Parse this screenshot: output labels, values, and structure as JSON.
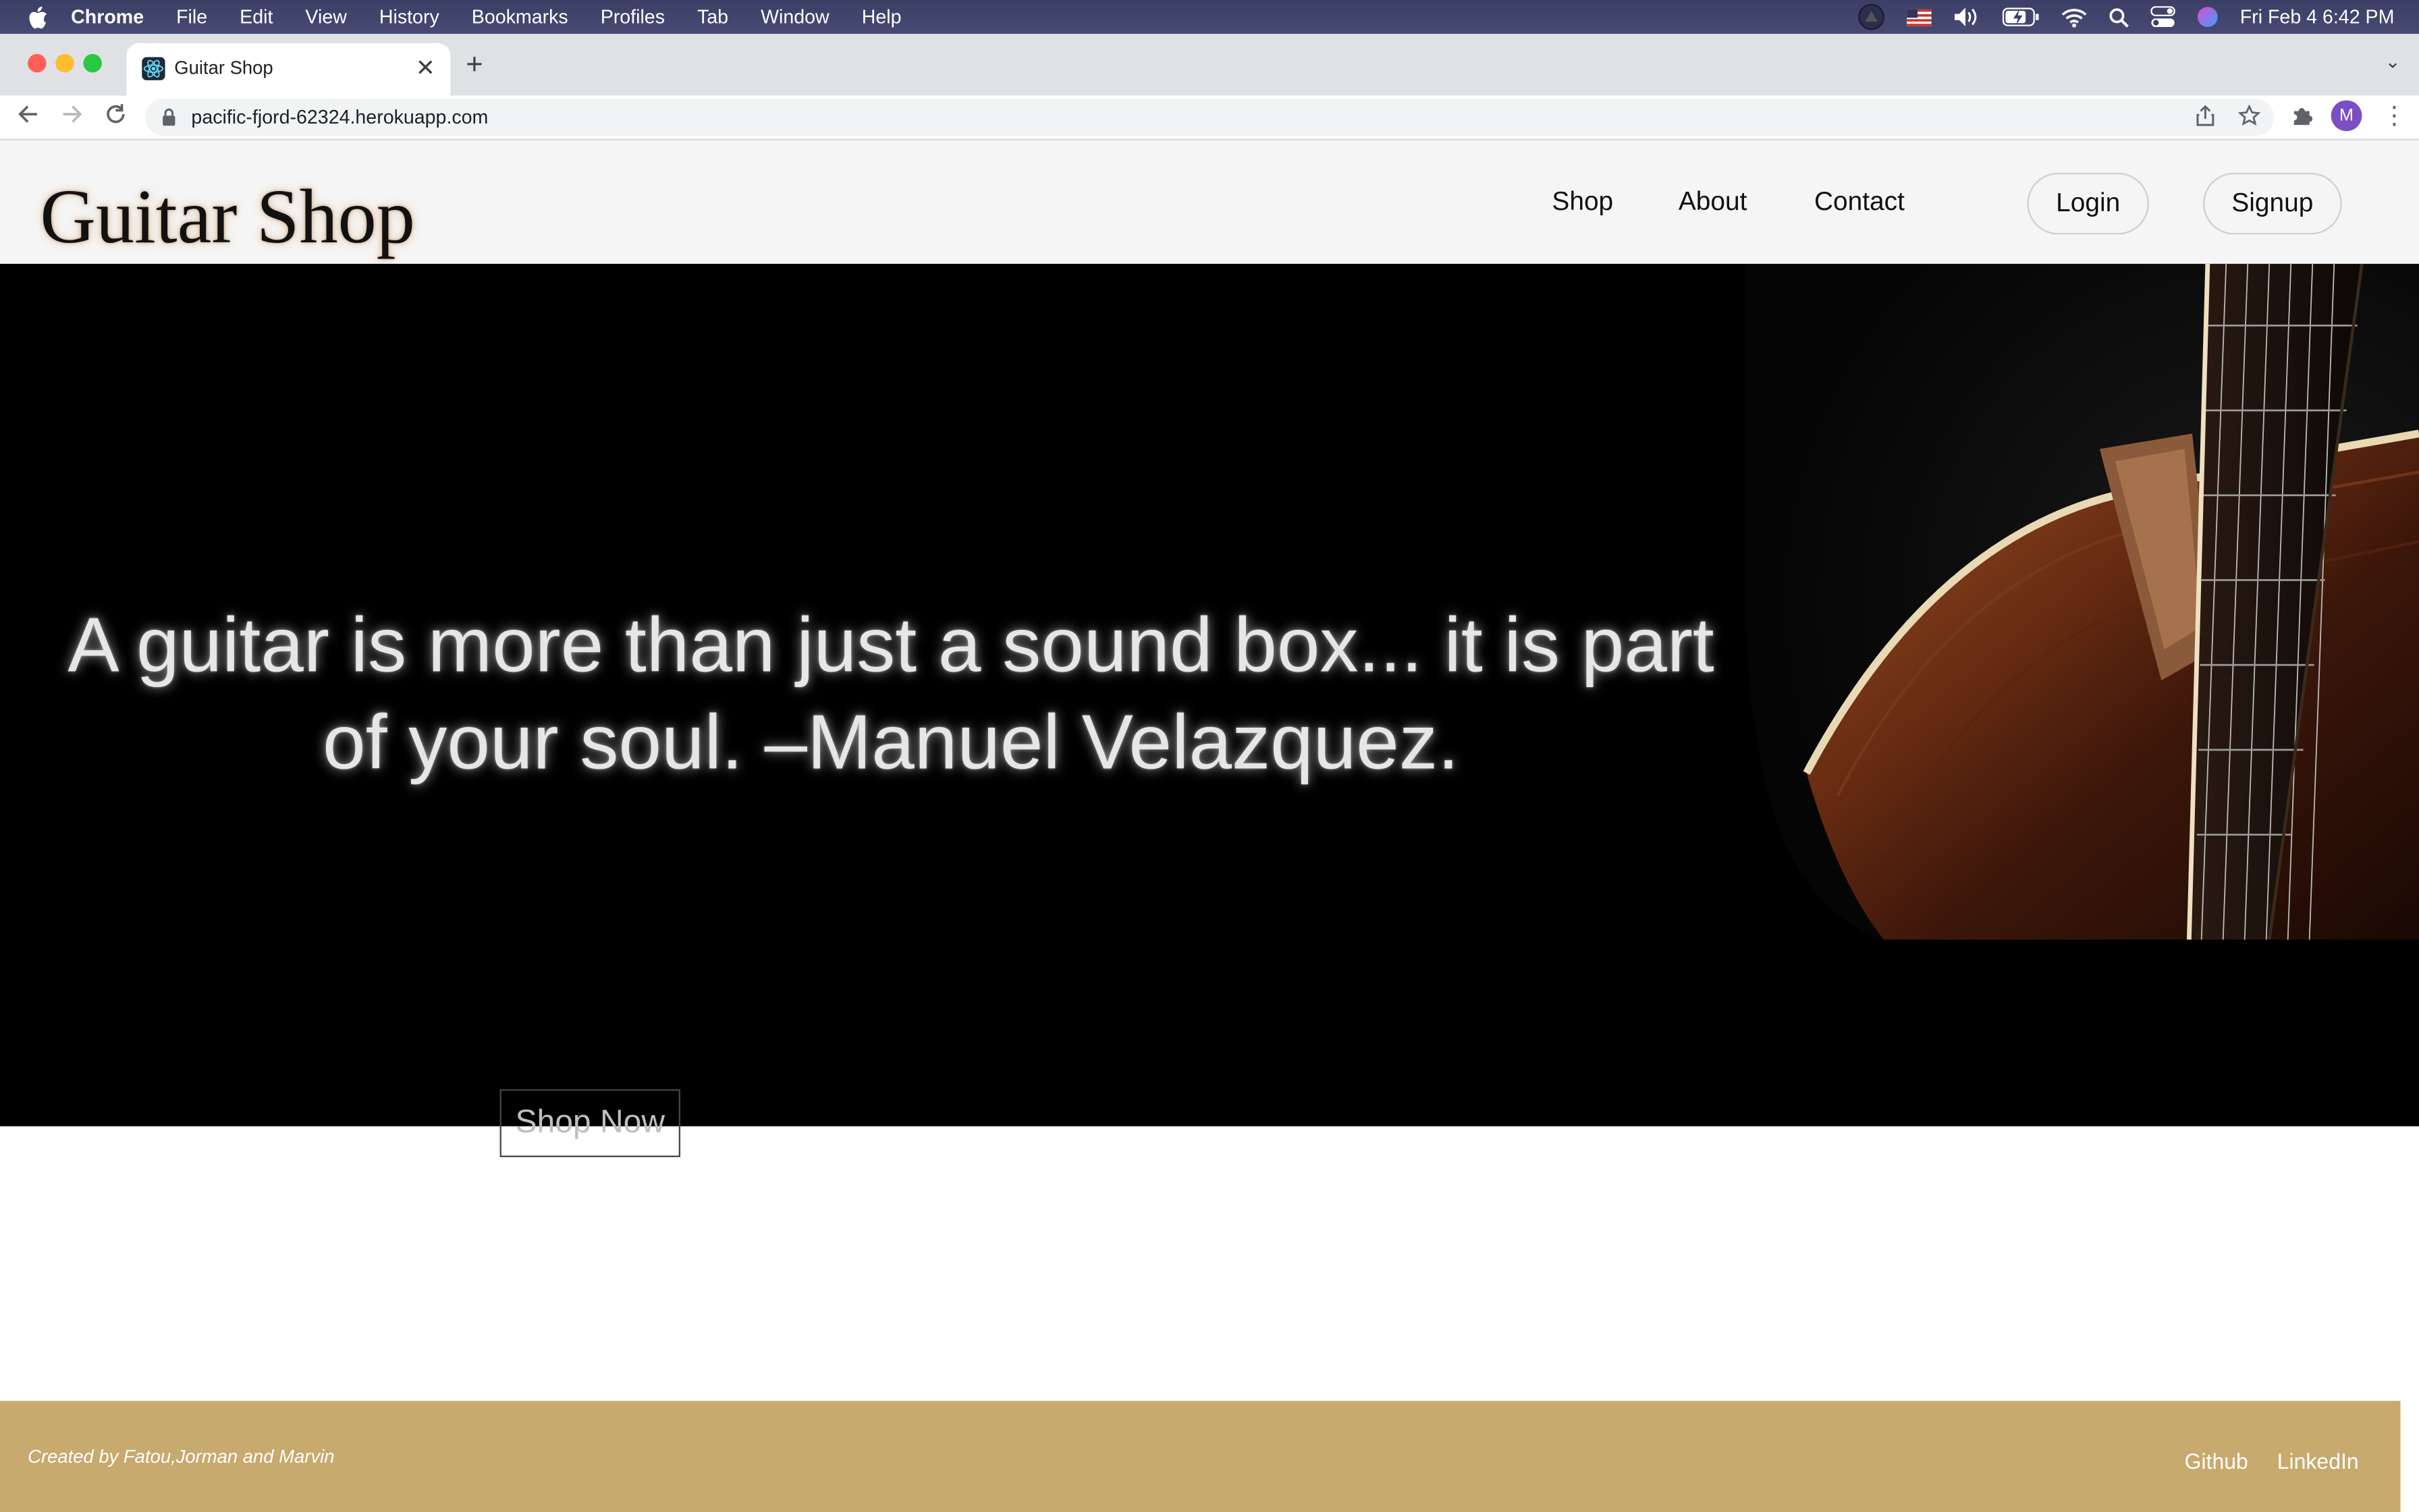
{
  "menubar": {
    "app": "Chrome",
    "menus": [
      "File",
      "Edit",
      "View",
      "History",
      "Bookmarks",
      "Profiles",
      "Tab",
      "Window",
      "Help"
    ],
    "clock": "Fri Feb 4  6:42 PM"
  },
  "browser": {
    "tab_title": "Guitar Shop",
    "url": "pacific-fjord-62324.herokuapp.com",
    "profile_initial": "M"
  },
  "site": {
    "brand": "Guitar Shop",
    "nav": [
      "Shop",
      "About",
      "Contact"
    ],
    "login": "Login",
    "signup": "Signup",
    "hero_quote": "A guitar is more than just a sound box... it is part of your soul. –Manuel Velazquez.",
    "cta": "Shop Now",
    "footer_credits": "Created by Fatou,Jorman and Marvin",
    "footer_links": [
      "Github",
      "LinkedIn"
    ]
  },
  "colors": {
    "footer_bg": "#c8a96e",
    "hero_bg": "#000000",
    "header_bg": "#f5f5f5"
  }
}
